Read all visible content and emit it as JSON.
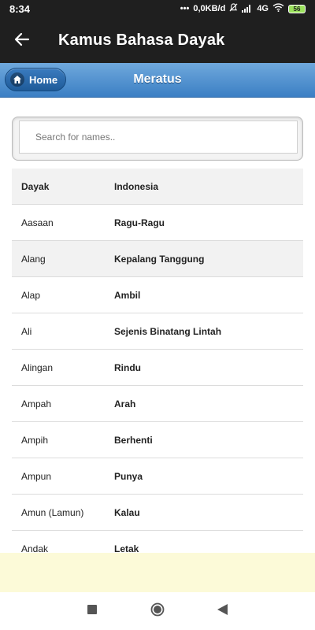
{
  "status_bar": {
    "time": "8:34",
    "net_speed": "0,0KB/d",
    "network_type": "4G",
    "battery_level": "56",
    "icons": [
      "dots-icon",
      "mute-icon",
      "signal-icon",
      "wifi-icon",
      "battery-icon"
    ]
  },
  "app_bar": {
    "title": "Kamus Bahasa Dayak",
    "back_icon": "arrow-back-icon"
  },
  "sub_header": {
    "home_label": "Home",
    "home_icon": "home-icon",
    "title": "Meratus"
  },
  "search": {
    "placeholder": "Search for names..",
    "value": ""
  },
  "table": {
    "headers": [
      "Dayak",
      "Indonesia"
    ],
    "rows": [
      {
        "dayak": "Aasaan",
        "indonesia": "Ragu-Ragu"
      },
      {
        "dayak": "Alang",
        "indonesia": "Kepalang Tanggung"
      },
      {
        "dayak": "Alap",
        "indonesia": "Ambil"
      },
      {
        "dayak": "Ali",
        "indonesia": "Sejenis Binatang Lintah"
      },
      {
        "dayak": "Alingan",
        "indonesia": "Rindu"
      },
      {
        "dayak": "Ampah",
        "indonesia": "Arah"
      },
      {
        "dayak": "Ampih",
        "indonesia": "Berhenti"
      },
      {
        "dayak": "Ampun",
        "indonesia": "Punya"
      },
      {
        "dayak": "Amun (Lamun)",
        "indonesia": "Kalau"
      },
      {
        "dayak": "Andak",
        "indonesia": "Letak"
      }
    ]
  },
  "nav_bar": {
    "icons": [
      "recents-square-icon",
      "home-circle-icon",
      "back-triangle-icon"
    ]
  },
  "colors": {
    "app_bar": "#1f1f1f",
    "header_gradient_top": "#6fa8dc",
    "header_gradient_bottom": "#3b7fc4",
    "ad_banner": "#fcfad8"
  }
}
